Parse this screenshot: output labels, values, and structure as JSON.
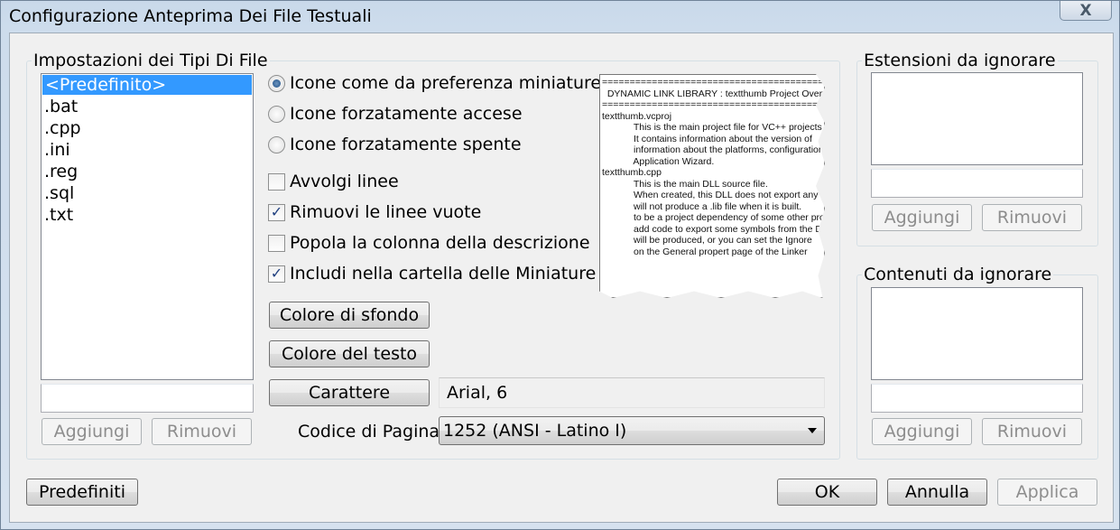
{
  "window": {
    "title": "Configurazione Anteprima Dei File Testuali",
    "close_glyph": "X"
  },
  "file_types": {
    "group_label": "Impostazioni dei Tipi Di File",
    "items": [
      "<Predefinito>",
      ".bat",
      ".cpp",
      ".ini",
      ".reg",
      ".sql",
      ".txt"
    ],
    "selected_index": 0,
    "new_value": "",
    "add_label": "Aggiungi",
    "remove_label": "Rimuovi"
  },
  "options": {
    "radios": [
      {
        "label": "Icone come da preferenza miniature",
        "checked": true
      },
      {
        "label": "Icone forzatamente accese",
        "checked": false
      },
      {
        "label": "Icone forzatamente spente",
        "checked": false
      }
    ],
    "checkboxes": [
      {
        "label": "Avvolgi linee",
        "checked": false
      },
      {
        "label": "Rimuovi le linee vuote",
        "checked": true
      },
      {
        "label": "Popola la colonna della descrizione",
        "checked": false
      },
      {
        "label": "Includi nella cartella delle Miniature",
        "checked": true
      }
    ],
    "bg_color_label": "Colore di sfondo",
    "text_color_label": "Colore del testo",
    "font_button_label": "Carattere",
    "font_value": "Arial, 6",
    "codepage_label": "Codice di Pagina",
    "codepage_value": "1252  (ANSI - Latino I)"
  },
  "preview": {
    "lines": [
      "========================================================",
      "  DYNAMIC LINK LIBRARY : textthumb Project Overview",
      "========================================================",
      "textthumb.vcproj",
      "            This is the main project file for VC++ projects",
      "            It contains information about the version of",
      "            information about the platforms, configurations,",
      "            Application Wizard.",
      "textthumb.cpp",
      "            This is the main DLL source file.",
      "            When created, this DLL does not export any",
      "            will not produce a .lib file when it is built.",
      "            to be a project dependency of some other project",
      "            add code to export some symbols from the DLL",
      "            will be produced, or you can set the Ignore",
      "            on the General propert page of the Linker"
    ]
  },
  "ignore_extensions": {
    "group_label": "Estensioni da ignorare",
    "new_value": "",
    "add_label": "Aggiungi",
    "remove_label": "Rimuovi"
  },
  "ignore_contents": {
    "group_label": "Contenuti da ignorare",
    "new_value": "",
    "add_label": "Aggiungi",
    "remove_label": "Rimuovi"
  },
  "footer": {
    "defaults_label": "Predefiniti",
    "ok_label": "OK",
    "cancel_label": "Annulla",
    "apply_label": "Applica"
  }
}
